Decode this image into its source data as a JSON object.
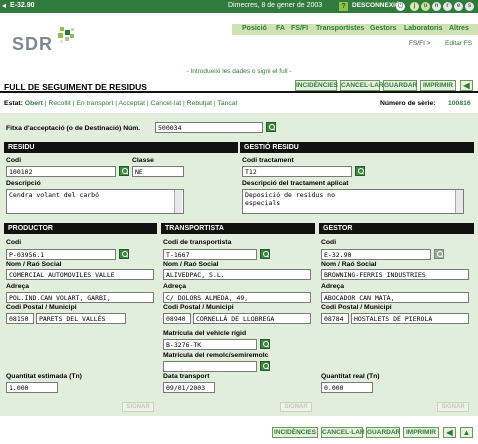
{
  "topbar": {
    "code": "E-32.90",
    "date": "Dimecres, 8 de gener de 2003",
    "help": "?",
    "logout": "DESCONNEXIÓ",
    "letters": [
      "j",
      "u",
      "n",
      "r",
      "e",
      "s"
    ]
  },
  "header": {
    "logo": "SDR",
    "nav": [
      "Posició",
      "FA",
      "FS/FI",
      "Transportistes",
      "Gestors",
      "Laboratoris",
      "Altres"
    ],
    "breadcrumb_parent": "FS/FI >",
    "breadcrumb_current": "Editar FS"
  },
  "hint": "- Introdueixi les dades o signi el full -",
  "form": {
    "title_bold": "FULL DE SEGUIMENT",
    "title_rest": " DE RESIDUS",
    "buttons": [
      "INCIDÈNCIES",
      "CANCEL·LAR",
      "GUARDAR",
      "IMPRIMIR"
    ],
    "state_label": "Estat:",
    "states": [
      "Obert",
      "Recollit",
      "En transport",
      "Acceptat",
      "Cancel·lat",
      "Rebutjat",
      "Tancat"
    ],
    "serial_label": "Número de sèrie:",
    "serial_value": "100816",
    "fitxa_label": "Fitxa d'acceptació (o de Destinació) Núm.",
    "fitxa_value": "500034"
  },
  "residu": {
    "header": "RESIDU",
    "codi_label": "Codi",
    "codi_value": "100102",
    "classe_label": "Classe",
    "classe_value": "NE",
    "desc_label": "Descripció",
    "desc_value": "Cendra volant del carbó"
  },
  "gestio": {
    "header": "GESTIÓ RESIDU",
    "codi_label": "Codi tractament",
    "codi_value": "T12",
    "desc_label": "Descripció del tractament aplicat",
    "desc_line1": "Deposició de residus no",
    "desc_line2": "especials"
  },
  "productor": {
    "header": "PRODUCTOR",
    "codi_label": "Codi",
    "codi_value": "P-03956.1",
    "nom_label": "Nom / Raó Social",
    "nom_value": "COMERCIAL AUTOMOVILES VALLE",
    "adreca_label": "Adreça",
    "adreca_value": " POL.IND.CAN VOLART, GARBI,",
    "cp_label": "Codi Postal / Municipi",
    "cp_value": "08150",
    "municipi_value": "PARETS DEL VALLÈS",
    "quant_label": "Quantitat estimada (Tn)",
    "quant_value": "1.000",
    "signar": "SIGNAR"
  },
  "transportista": {
    "header": "TRANSPORTISTA",
    "codi_label": "Codi de transportista",
    "codi_value": "T-1667",
    "nom_label": "Nom / Raó Social",
    "nom_value": "ALIVEDPAC, S.L.",
    "adreca_label": "Adreça",
    "adreca_value": "C/ DOLORS ALMEDA, 49,",
    "cp_label": "Codi Postal / Municipi",
    "cp_value": "08940",
    "municipi_value": "CORNELLÀ DE LLOBREGA",
    "matricula_label": "Matrícula del vehicle rígid",
    "matricula_value": "B-3276-TK",
    "remolc_label": "Matrícula del remolc/semiremolc",
    "remolc_value": "",
    "data_label": "Data transport",
    "data_value": "09/01/2003",
    "signar": "SIGNAR"
  },
  "gestor": {
    "header": "GESTOR",
    "codi_label": "Codi",
    "codi_value": "E-32.90",
    "nom_label": "Nom / Raó Social",
    "nom_value": "BROWNING-FERRIS INDUSTRIES",
    "adreca_label": "Adreça",
    "adreca_value": " ABOCADOR CAN MATA,",
    "cp_label": "Codi Postal / Municipi",
    "cp_value": "08784",
    "municipi_value": "HOSTALETS DE PIEROLA",
    "quant_label": "Quantitat real (Tn)",
    "quant_value": "0.000",
    "signar": "SIGNAR"
  },
  "footer_buttons": [
    "INCIDÈNCIES",
    "CANCEL·LAR",
    "GUARDAR",
    "IMPRIMIR"
  ],
  "colors": {
    "brand_green": "#2f7a3c",
    "panel": "#e2eedc",
    "nav": "#cfe2b4"
  }
}
